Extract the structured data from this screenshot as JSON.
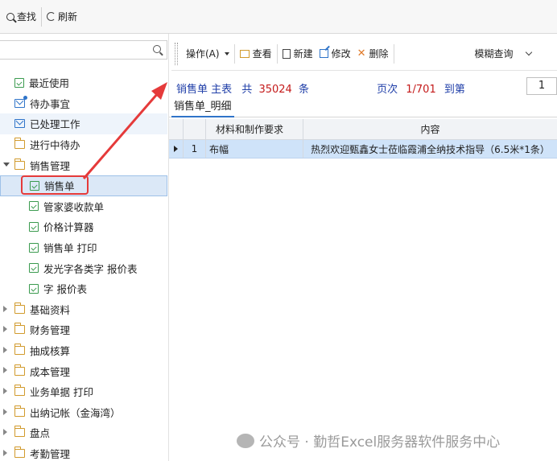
{
  "topbar": {
    "find_label": "查找",
    "refresh_label": "刷新"
  },
  "left_search": {
    "placeholder": ""
  },
  "tree": {
    "items": [
      {
        "label": "最近使用",
        "icon": "doc-icon"
      },
      {
        "label": "待办事宜",
        "icon": "mail-star-icon"
      },
      {
        "label": "已处理工作",
        "icon": "mail-icon"
      },
      {
        "label": "进行中待办",
        "icon": "folder-icon"
      },
      {
        "label": "销售管理",
        "icon": "folder-icon"
      },
      {
        "label": "销售单",
        "icon": "doc-icon"
      },
      {
        "label": "管家婆收款单",
        "icon": "doc-icon"
      },
      {
        "label": "价格计算器",
        "icon": "doc-icon"
      },
      {
        "label": "销售单 打印",
        "icon": "doc-icon"
      },
      {
        "label": "发光字各类字 报价表",
        "icon": "doc-icon"
      },
      {
        "label": "字 报价表",
        "icon": "doc-icon"
      },
      {
        "label": "基础资料",
        "icon": "folder-icon"
      },
      {
        "label": "财务管理",
        "icon": "folder-icon"
      },
      {
        "label": "抽成核算",
        "icon": "folder-icon"
      },
      {
        "label": "成本管理",
        "icon": "folder-icon"
      },
      {
        "label": "业务单据 打印",
        "icon": "folder-icon"
      },
      {
        "label": "出纳记帐（金海湾）",
        "icon": "folder-icon"
      },
      {
        "label": "盘点",
        "icon": "folder-icon"
      },
      {
        "label": "考勤管理",
        "icon": "folder-icon"
      }
    ]
  },
  "toolbar": {
    "operate_label": "操作(A)",
    "view_label": "查看",
    "new_label": "新建",
    "edit_label": "修改",
    "delete_label": "删除",
    "fuzzy_label": "模糊查询"
  },
  "pager": {
    "title": "销售单 主表",
    "total_prefix": "共",
    "total": "35024",
    "total_suffix": "条",
    "page_prefix": "页次",
    "page": "1/701",
    "goto_label": "到第",
    "goto_value": "1"
  },
  "detail": {
    "tab_label": "销售单_明细",
    "columns": [
      "材料和制作要求",
      "内容"
    ],
    "rows": [
      {
        "no": "1",
        "material": "布幅",
        "content": "热烈欢迎甄鑫女士莅临霞浦全纳技术指导（6.5米*1条）"
      }
    ]
  },
  "watermark": {
    "text": "公众号 · 勤哲Excel服务器软件服务中心"
  },
  "colors": {
    "highlight_red": "#e53a3a",
    "selection_blue": "#cfe3f9",
    "pager_blue": "#1f3ea8"
  }
}
